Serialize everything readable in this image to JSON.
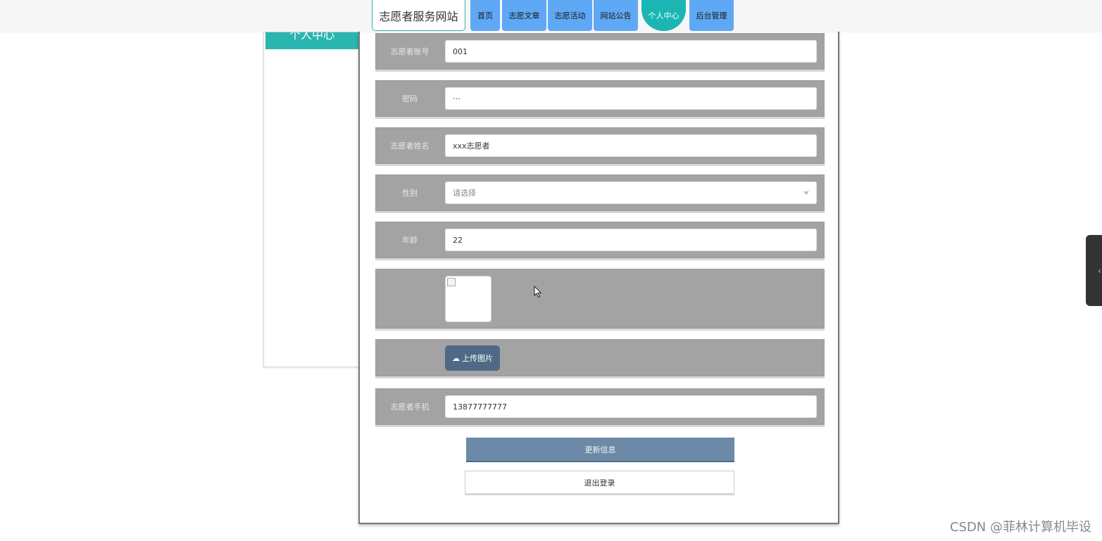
{
  "nav": {
    "brand": "志愿者服务网站",
    "items": [
      {
        "label": "首页"
      },
      {
        "label": "志愿文章"
      },
      {
        "label": "志愿活动"
      },
      {
        "label": "网站公告"
      },
      {
        "label": "个人中心",
        "active": true
      },
      {
        "label": "后台管理"
      }
    ]
  },
  "sidebar": {
    "title": "个人中心"
  },
  "form": {
    "account": {
      "label": "志愿者账号",
      "value": "001"
    },
    "password": {
      "label": "密码",
      "value": "···"
    },
    "name": {
      "label": "志愿者姓名",
      "value": "xxx志愿者"
    },
    "gender": {
      "label": "性别",
      "placeholder": "请选择"
    },
    "age": {
      "label": "年龄",
      "value": "22"
    },
    "upload_label": "上传图片",
    "phone": {
      "label": "志愿者手机",
      "value": "13877777777"
    },
    "update_button": "更新信息",
    "logout_button": "退出登录"
  },
  "watermark": "CSDN @菲林计算机毕设",
  "colors": {
    "nav_blue": "#5fa8f5",
    "active_teal": "#1bb5b4",
    "row_gray": "#a3a3a3",
    "update_btn": "#6c8aa7",
    "upload_btn": "#506a85"
  }
}
